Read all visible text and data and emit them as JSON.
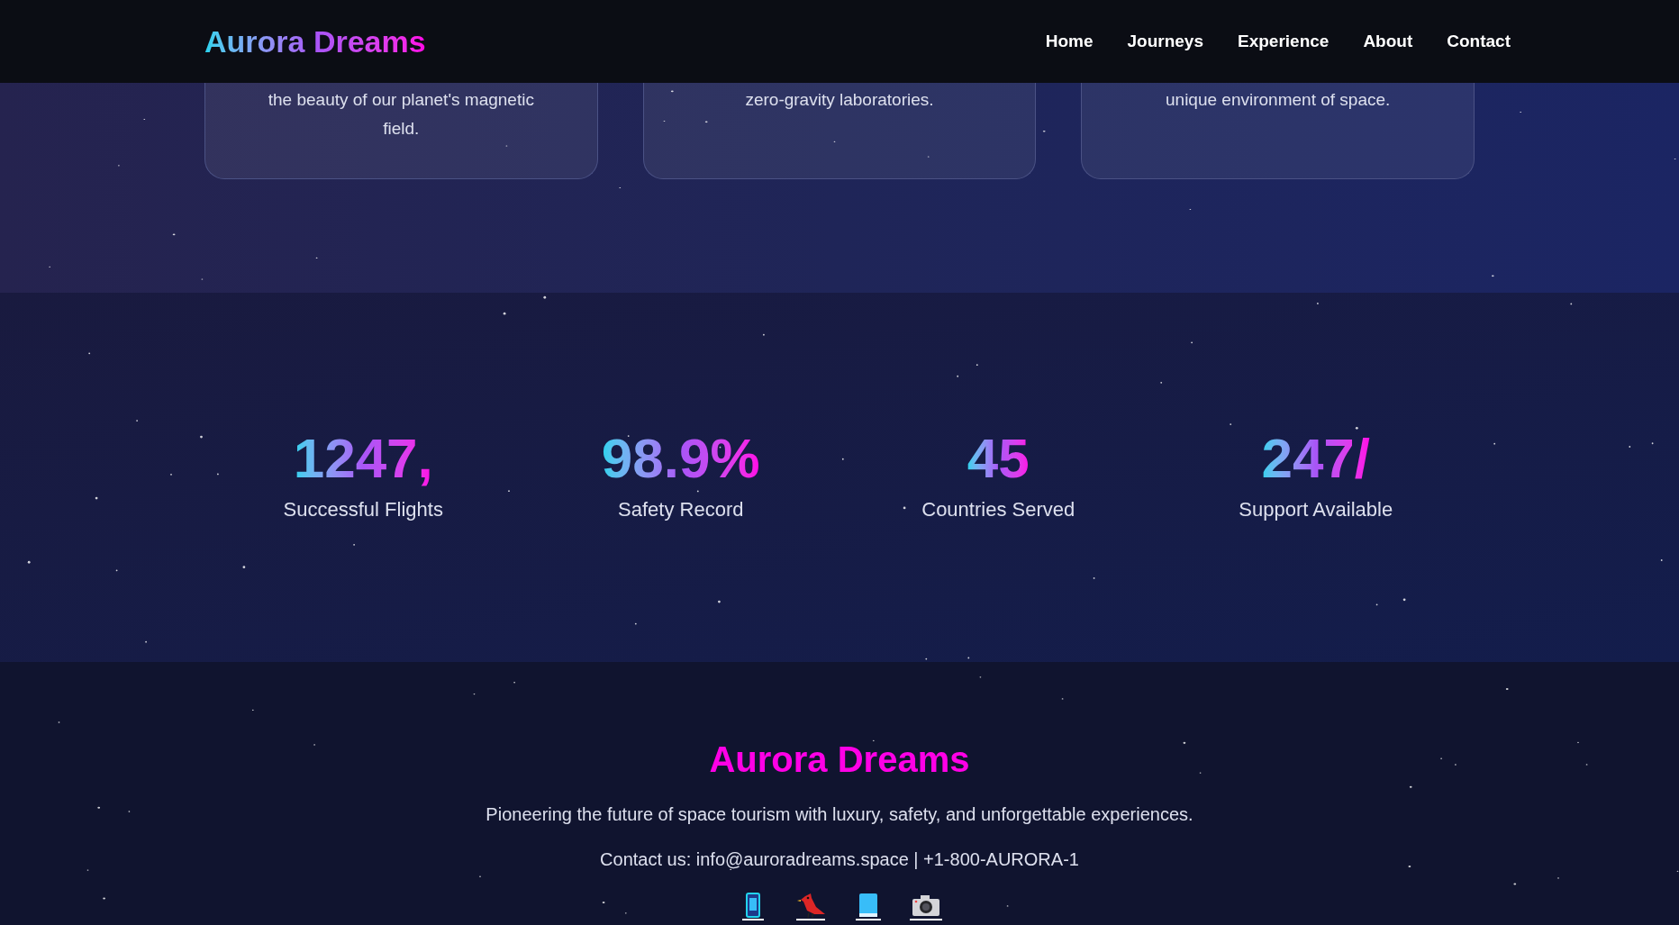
{
  "nav": {
    "logo": "Aurora Dreams",
    "links": [
      {
        "label": "Home"
      },
      {
        "label": "Journeys"
      },
      {
        "label": "Experience"
      },
      {
        "label": "About"
      },
      {
        "label": "Contact"
      }
    ]
  },
  "cards": [
    {
      "text": "the beauty of our planet's magnetic field."
    },
    {
      "text": "zero-gravity laboratories."
    },
    {
      "text": "unique environment of space."
    }
  ],
  "stats": [
    {
      "value": "1247,",
      "label": "Successful Flights"
    },
    {
      "value": "98.9%",
      "label": "Safety Record"
    },
    {
      "value": "45",
      "label": "Countries Served"
    },
    {
      "value": "247/",
      "label": "Support Available"
    }
  ],
  "footer": {
    "title": "Aurora Dreams",
    "tagline": "Pioneering the future of space tourism with luxury, safety, and unforgettable experiences.",
    "contact": "Contact us: info@auroradreams.space | +1-800-AURORA-1",
    "social": [
      {
        "kind": "phone"
      },
      {
        "kind": "bird"
      },
      {
        "kind": "book"
      },
      {
        "kind": "camera"
      }
    ]
  }
}
